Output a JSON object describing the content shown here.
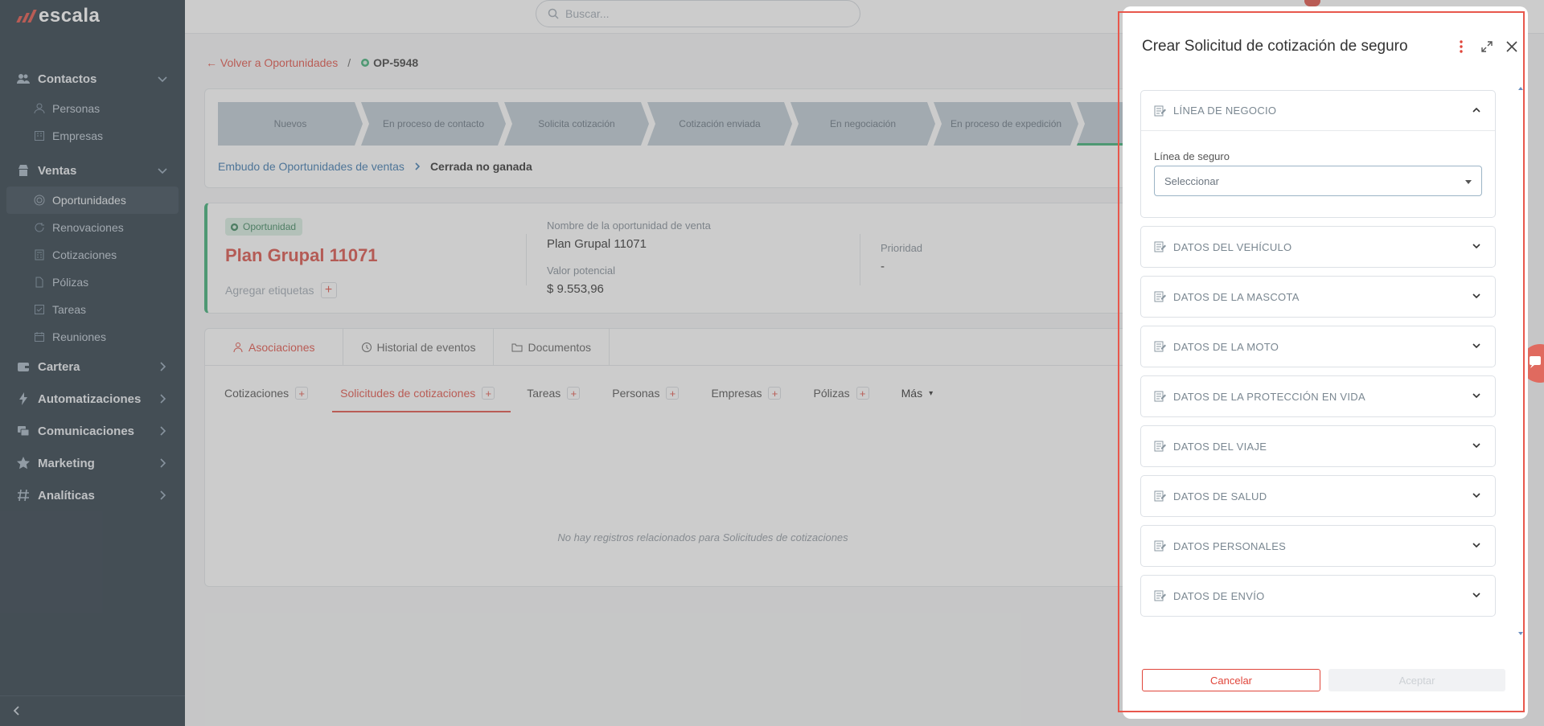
{
  "app": {
    "logo_text": "escala"
  },
  "sidebar": {
    "sections": [
      {
        "label": "Contactos",
        "icon": "people-icon",
        "expanded": true
      },
      {
        "label": "Ventas",
        "icon": "store-icon",
        "expanded": true
      },
      {
        "label": "Cartera",
        "icon": "wallet-icon",
        "expanded": false
      },
      {
        "label": "Automatizaciones",
        "icon": "bolt-icon",
        "expanded": false
      },
      {
        "label": "Comunicaciones",
        "icon": "chat-icon",
        "expanded": false
      },
      {
        "label": "Marketing",
        "icon": "star-icon",
        "expanded": false
      },
      {
        "label": "Analíticas",
        "icon": "hash-icon",
        "expanded": false
      }
    ],
    "contactos_items": [
      "Personas",
      "Empresas"
    ],
    "ventas_items": [
      "Oportunidades",
      "Renovaciones",
      "Cotizaciones",
      "Pólizas",
      "Tareas",
      "Reuniones"
    ],
    "active_item": "Oportunidades"
  },
  "topbar": {
    "search_placeholder": "Buscar..."
  },
  "breadcrumb": {
    "back": "Volver a Oportunidades",
    "separator": "/",
    "current": "OP-5948"
  },
  "pipeline": {
    "stages": [
      "Nuevos",
      "En proceso de contacto",
      "Solicita cotización",
      "Cotización enviada",
      "En negociación",
      "En proceso de expedición"
    ],
    "funnel": "Embudo de Oportunidades de ventas",
    "status": "Cerrada no ganada"
  },
  "opportunity": {
    "badge": "Oportunidad",
    "title": "Plan Grupal 11071",
    "add_tags": "Agregar etiquetas",
    "name_label": "Nombre de la oportunidad de venta",
    "name_value": "Plan Grupal 11071",
    "value_label": "Valor potencial",
    "value_value": "$ 9.553,96",
    "priority_label": "Prioridad",
    "priority_value": "-"
  },
  "associations": {
    "tabs": [
      "Asociaciones",
      "Historial de eventos",
      "Documentos"
    ],
    "subtabs": [
      "Cotizaciones",
      "Solicitudes de cotizaciones",
      "Tareas",
      "Personas",
      "Empresas",
      "Pólizas"
    ],
    "more": "Más",
    "active_subtab": "Solicitudes de cotizaciones",
    "empty_message": "No hay registros relacionados para Solicitudes de cotizaciones"
  },
  "dialog": {
    "title": "Crear Solicitud de cotización de seguro",
    "sections": [
      "LÍNEA DE NEGOCIO",
      "DATOS DEL VEHÍCULO",
      "DATOS DE LA MASCOTA",
      "DATOS DE LA MOTO",
      "DATOS DE LA PROTECCIÓN EN VIDA",
      "DATOS DEL VIAJE",
      "DATOS DE SALUD",
      "DATOS PERSONALES",
      "DATOS DE ENVÍO"
    ],
    "line_label": "Línea de seguro",
    "line_placeholder": "Seleccionar",
    "cancel": "Cancelar",
    "accept": "Aceptar"
  },
  "colors": {
    "accent": "#e0453a",
    "sidebar_bg": "#1d2d3a",
    "success": "#2ea86b"
  }
}
